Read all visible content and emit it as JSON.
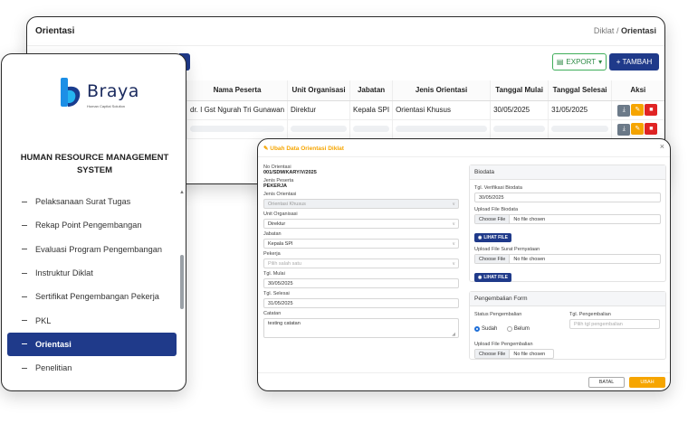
{
  "list": {
    "title": "Orientasi",
    "breadcrumb": [
      "Diklat",
      "Orientasi"
    ],
    "breadcrumb_sep": "/",
    "export_label": "EXPORT",
    "tambah_label": "+ TAMBAH",
    "columns": [
      "Nama Peserta",
      "Unit Organisasi",
      "Jabatan",
      "Jenis Orientasi",
      "Tanggal Mulai",
      "Tanggal Selesai",
      "Aksi"
    ],
    "rows": [
      [
        "dr. I Gst Ngurah Tri Gunawan",
        "Direktur",
        "Kepala SPI",
        "Orientasi Khusus",
        "30/05/2025",
        "31/05/2025"
      ]
    ]
  },
  "sidebar": {
    "logo_text": "Braya",
    "logo_sub": "Human Capital Solution",
    "app_title_line1": "HUMAN RESOURCE MANAGEMENT",
    "app_title_line2": "SYSTEM",
    "items": [
      {
        "label": "Pelaksanaan Surat Tugas"
      },
      {
        "label": "Rekap Point Pengembangan"
      },
      {
        "label": "Evaluasi Program Pengembangan"
      },
      {
        "label": "Instruktur Diklat"
      },
      {
        "label": "Sertifikat Pengembangan Pekerja"
      },
      {
        "label": "PKL"
      },
      {
        "label": "Orientasi",
        "active": true
      },
      {
        "label": "Penelitian"
      }
    ]
  },
  "modal": {
    "title": "Ubah Data Orientasi Diklat",
    "close": "×",
    "no_orientasi_label": "No Orientasi",
    "no_orientasi": "001/SDM/KARY/V/2025",
    "jenis_peserta_label": "Jenis Peserta",
    "jenis_peserta": "PEKERJA",
    "jenis_orientasi_label": "Jenis Orientasi",
    "jenis_orientasi": "Orientasi Khusus",
    "unit_label": "Unit Organisasi",
    "unit": "Direktur",
    "jabatan_label": "Jabatan",
    "jabatan": "Kepala SPI",
    "pekerja_label": "Pekerja",
    "pekerja_placeholder": "Pilih salah satu",
    "tgl_mulai_label": "Tgl. Mulai",
    "tgl_mulai": "30/05/2025",
    "tgl_selesai_label": "Tgl. Selesai",
    "tgl_selesai": "31/05/2025",
    "catatan_label": "Catatan",
    "catatan": "testing catatan",
    "biodata": {
      "header": "Biodata",
      "tgl_verif_label": "Tgl. Verifikasi Biodata",
      "tgl_verif": "30/05/2025",
      "upload_biodata_label": "Upload File Biodata",
      "choose_file": "Choose File",
      "no_file": "No file chosen",
      "lihat_file": "LIHAT FILE",
      "upload_pernyataan_label": "Upload File Surat Pernyataan"
    },
    "pengembalian": {
      "header": "Pengembalian Form",
      "status_label": "Status Pengembalian",
      "opt_sudah": "Sudah",
      "opt_belum": "Belum",
      "tgl_label": "Tgl. Pengembalian",
      "tgl_placeholder": "Pilih tgl pengembalian",
      "upload_label": "Upload File Pengembalian"
    },
    "batal": "BATAL",
    "ubah": "UBAH"
  }
}
